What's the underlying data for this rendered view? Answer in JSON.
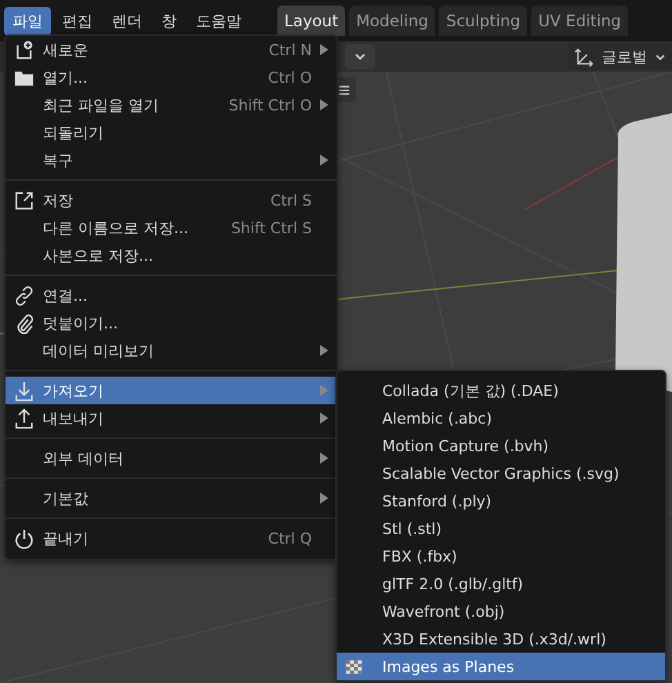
{
  "menubar": [
    {
      "label": "파일",
      "selected": true
    },
    {
      "label": "편집",
      "selected": false
    },
    {
      "label": "렌더",
      "selected": false
    },
    {
      "label": "창",
      "selected": false
    },
    {
      "label": "도움말",
      "selected": false
    }
  ],
  "workspace_tabs": [
    {
      "label": "Layout",
      "selected": true
    },
    {
      "label": "Modeling",
      "selected": false
    },
    {
      "label": "Sculpting",
      "selected": false
    },
    {
      "label": "UV Editing",
      "selected": false
    }
  ],
  "header": {
    "transform_orientation": "글로벌"
  },
  "file_menu": {
    "items": [
      {
        "kind": "item",
        "label": "새로운",
        "shortcut": "Ctrl N",
        "has_submenu": true,
        "selected": false
      },
      {
        "kind": "item",
        "label": "열기...",
        "shortcut": "Ctrl O",
        "selected": false
      },
      {
        "kind": "item",
        "label": "최근 파일을 열기",
        "shortcut": "Shift Ctrl O",
        "has_submenu": true,
        "selected": false
      },
      {
        "kind": "item",
        "label": "되돌리기",
        "selected": false
      },
      {
        "kind": "item",
        "label": "복구",
        "has_submenu": true,
        "selected": false
      },
      {
        "kind": "separator"
      },
      {
        "kind": "item",
        "label": "저장",
        "shortcut": "Ctrl S",
        "selected": false
      },
      {
        "kind": "item",
        "label": "다른 이름으로 저장...",
        "shortcut": "Shift Ctrl S",
        "selected": false
      },
      {
        "kind": "item",
        "label": "사본으로 저장...",
        "selected": false
      },
      {
        "kind": "separator"
      },
      {
        "kind": "item",
        "label": "연결...",
        "selected": false
      },
      {
        "kind": "item",
        "label": "덧붙이기...",
        "selected": false
      },
      {
        "kind": "item",
        "label": "데이터 미리보기",
        "has_submenu": true,
        "selected": false
      },
      {
        "kind": "separator"
      },
      {
        "kind": "item",
        "label": "가져오기",
        "has_submenu": true,
        "selected": true
      },
      {
        "kind": "item",
        "label": "내보내기",
        "has_submenu": true,
        "selected": false
      },
      {
        "kind": "separator"
      },
      {
        "kind": "item",
        "label": "외부 데이터",
        "has_submenu": true,
        "selected": false
      },
      {
        "kind": "separator"
      },
      {
        "kind": "item",
        "label": "기본값",
        "has_submenu": true,
        "selected": false
      },
      {
        "kind": "separator"
      },
      {
        "kind": "item",
        "label": "끝내기",
        "shortcut": "Ctrl Q",
        "selected": false
      }
    ]
  },
  "import_submenu": {
    "items": [
      {
        "label": "Collada (기본 값) (.DAE)",
        "selected": false
      },
      {
        "label": "Alembic (.abc)",
        "selected": false
      },
      {
        "label": "Motion Capture (.bvh)",
        "selected": false
      },
      {
        "label": "Scalable Vector Graphics (.svg)",
        "selected": false
      },
      {
        "label": "Stanford (.ply)",
        "selected": false
      },
      {
        "label": "Stl (.stl)",
        "selected": false
      },
      {
        "label": "FBX (.fbx)",
        "selected": false
      },
      {
        "label": "glTF 2.0 (.glb/.gltf)",
        "selected": false
      },
      {
        "label": "Wavefront (.obj)",
        "selected": false
      },
      {
        "label": "X3D Extensible 3D (.x3d/.wrl)",
        "selected": false
      },
      {
        "label": "Images as Planes",
        "selected": true
      }
    ]
  }
}
